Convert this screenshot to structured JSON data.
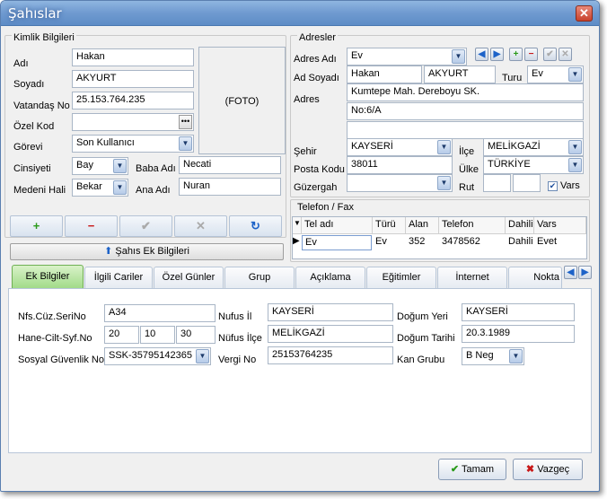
{
  "window": {
    "title": "Şahıslar",
    "close_glyph": "✕"
  },
  "kimlik": {
    "group_title": "Kimlik Bilgileri",
    "labels": {
      "adi": "Adı",
      "soyadi": "Soyadı",
      "vatandas_no": "Vatandaş No",
      "ozel_kod": "Özel Kod",
      "gorevi": "Görevi",
      "cinsiyeti": "Cinsiyeti",
      "medeni_hali": "Medeni Hali",
      "baba_adi": "Baba Adı",
      "ana_adi": "Ana Adı"
    },
    "values": {
      "adi": "Hakan",
      "soyadi": "AKYURT",
      "vatandas_no": "25.153.764.235",
      "ozel_kod": "",
      "gorevi": "Son Kullanıcı",
      "cinsiyeti": "Bay",
      "medeni_hali": "Bekar",
      "baba_adi": "Necati",
      "ana_adi": "Nuran"
    },
    "foto": "(FOTO)",
    "ek_bilgiler_button": "Şahıs Ek Bilgileri"
  },
  "adresler": {
    "group_title": "Adresler",
    "labels": {
      "adres_adi": "Adres Adı",
      "ad_soyadi": "Ad Soyadı",
      "turu": "Turu",
      "adres": "Adres",
      "sehir": "Şehir",
      "ilce": "İlçe",
      "posta_kodu": "Posta Kodu",
      "ulke": "Ülke",
      "guzergah": "Güzergah",
      "rut": "Rut",
      "vars": "Vars"
    },
    "values": {
      "adres_adi": "Ev",
      "ad": "Hakan",
      "soyad": "AKYURT",
      "turu": "Ev",
      "adres_1": "Kumtepe Mah. Dereboyu SK.",
      "adres_2": "No:6/A",
      "adres_3": "",
      "sehir": "KAYSERİ",
      "ilce": "MELİKGAZİ",
      "posta_kodu": "38011",
      "ulke": "TÜRKİYE",
      "guzergah": "",
      "rut_1": "",
      "rut_2": "",
      "vars_checked": "✔"
    }
  },
  "telefon": {
    "group_title": "Telefon / Fax",
    "columns": [
      "Tel adı",
      "Türü",
      "Alan",
      "Telefon",
      "Dahili",
      "Vars"
    ],
    "rows": [
      [
        "Ev",
        "Ev",
        "352",
        "3478562",
        "Dahili",
        "Evet"
      ]
    ]
  },
  "tabs": [
    "Ek Bilgiler",
    "İlgili Cariler",
    "Özel Günler",
    "Grup",
    "Açıklama",
    "Eğitimler",
    "İnternet",
    "Nokta"
  ],
  "ek_bilgiler": {
    "labels": {
      "nfs": "Nfs.Cüz.SeriNo",
      "hane": "Hane-Cilt-Syf.No",
      "sgk": "Sosyal Güvenlik No",
      "nufus_il": "Nufus İl",
      "nufus_ilce": "Nüfus İlçe",
      "vergi_no": "Vergi No",
      "dogum_yeri": "Doğum Yeri",
      "dogum_tarihi": "Doğum Tarihi",
      "kan_grubu": "Kan Grubu"
    },
    "values": {
      "nfs": "A34",
      "hane_1": "20",
      "hane_2": "10",
      "hane_3": "30",
      "sgk": "SSK-35795142365",
      "nufus_il": "KAYSERİ",
      "nufus_ilce": "MELİKGAZİ",
      "vergi_no": "25153764235",
      "dogum_yeri": "KAYSERİ",
      "dogum_tarihi": "20.3.1989",
      "kan_grubu": "B Neg"
    }
  },
  "buttons": {
    "ok": "Tamam",
    "cancel": "Vazgeç"
  }
}
